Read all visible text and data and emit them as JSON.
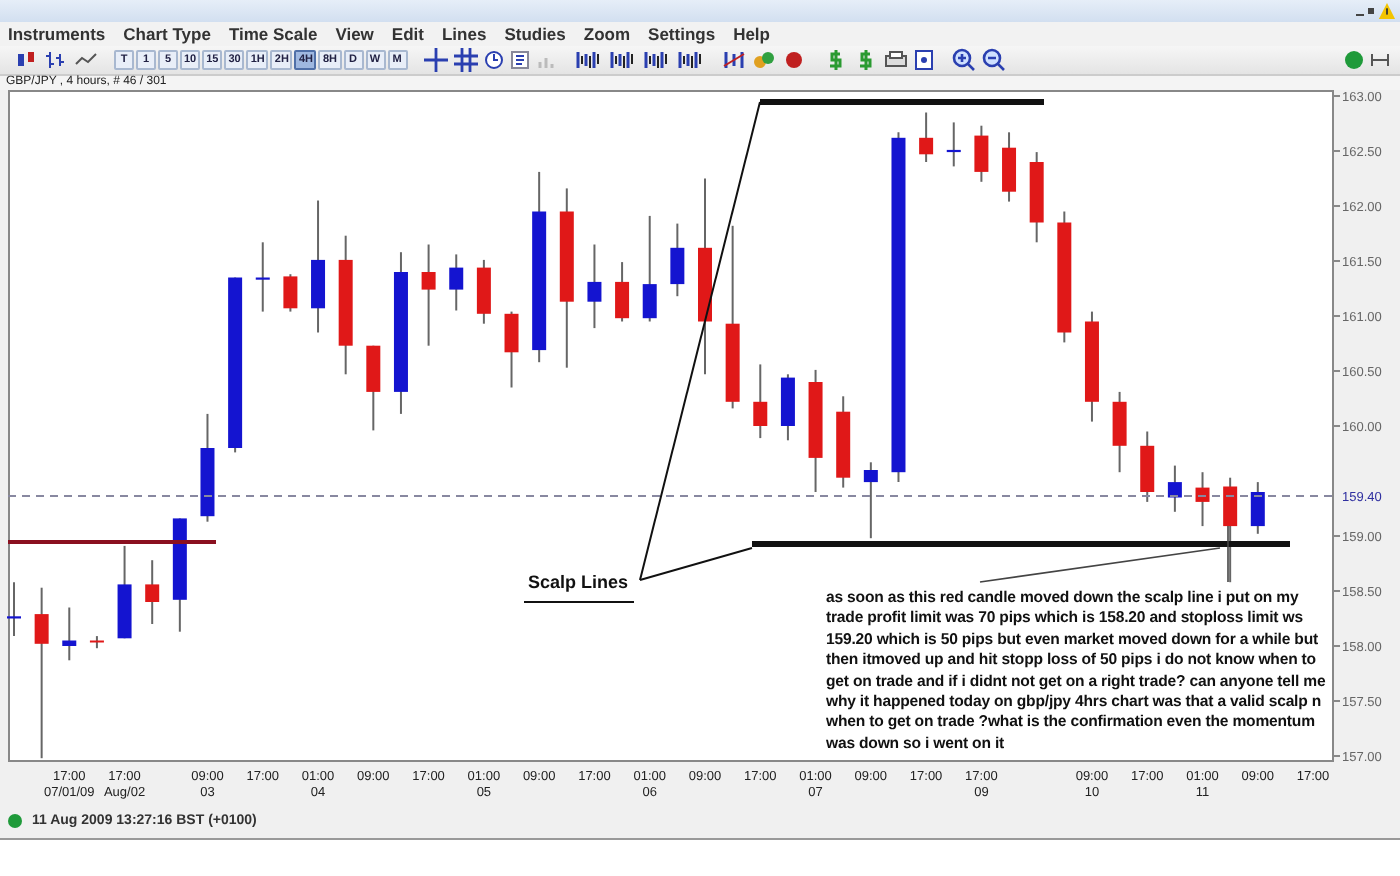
{
  "menu": [
    "Instruments",
    "Chart Type",
    "Time Scale",
    "View",
    "Edit",
    "Lines",
    "Studies",
    "Zoom",
    "Settings",
    "Help"
  ],
  "timeframes": [
    {
      "label": "T",
      "selected": false
    },
    {
      "label": "1",
      "selected": false
    },
    {
      "label": "5",
      "selected": false
    },
    {
      "label": "10",
      "selected": false
    },
    {
      "label": "15",
      "selected": false
    },
    {
      "label": "30",
      "selected": false
    },
    {
      "label": "1H",
      "selected": false
    },
    {
      "label": "2H",
      "selected": false
    },
    {
      "label": "4H",
      "selected": true
    },
    {
      "label": "8H",
      "selected": false
    },
    {
      "label": "D",
      "selected": false
    },
    {
      "label": "W",
      "selected": false
    },
    {
      "label": "M",
      "selected": false
    }
  ],
  "chart": {
    "info": "GBP/JPY , 4 hours, # 46 / 301",
    "chart_data": {
      "type": "candlestick",
      "categories": [
        null,
        null,
        "17:00\n07/01/09",
        null,
        "17:00\nAug/02",
        null,
        null,
        "09:00\n03",
        null,
        "17:00",
        null,
        "01:00\n04",
        null,
        "09:00",
        null,
        "17:00",
        null,
        "01:00\n05",
        null,
        "09:00",
        null,
        "17:00",
        null,
        "01:00\n06",
        null,
        "09:00",
        null,
        "17:00",
        null,
        "01:00\n07",
        null,
        "09:00",
        null,
        "17:00",
        null,
        "17:00\n09",
        null,
        null,
        null,
        "09:00\n10",
        null,
        "17:00",
        null,
        "01:00\n11",
        null,
        "09:00",
        null,
        "17:00"
      ],
      "ohlc": [
        [
          158.25,
          158.58,
          158.09,
          158.27
        ],
        [
          158.29,
          158.53,
          156.98,
          158.02
        ],
        [
          158.0,
          158.35,
          157.87,
          158.05
        ],
        [
          158.05,
          158.09,
          157.98,
          158.04
        ],
        [
          158.07,
          158.91,
          158.07,
          158.56
        ],
        [
          158.56,
          158.78,
          158.2,
          158.4
        ],
        [
          158.42,
          159.16,
          158.13,
          159.16
        ],
        [
          159.18,
          160.11,
          159.13,
          159.8
        ],
        [
          159.8,
          161.35,
          159.76,
          161.35
        ],
        [
          161.33,
          161.67,
          161.04,
          161.35
        ],
        [
          161.36,
          161.38,
          161.04,
          161.07
        ],
        [
          161.07,
          162.05,
          160.85,
          161.51
        ],
        [
          161.51,
          161.73,
          160.47,
          160.73
        ],
        [
          160.73,
          160.73,
          159.96,
          160.31
        ],
        [
          160.31,
          161.58,
          160.11,
          161.4
        ],
        [
          161.4,
          161.65,
          160.73,
          161.24
        ],
        [
          161.24,
          161.56,
          161.05,
          161.44
        ],
        [
          161.44,
          161.51,
          160.93,
          161.02
        ],
        [
          161.02,
          161.04,
          160.35,
          160.67
        ],
        [
          160.69,
          162.31,
          160.58,
          161.95
        ],
        [
          161.95,
          162.16,
          160.53,
          161.13
        ],
        [
          161.13,
          161.65,
          160.89,
          161.31
        ],
        [
          161.31,
          161.49,
          160.95,
          160.98
        ],
        [
          160.98,
          161.91,
          160.95,
          161.29
        ],
        [
          161.29,
          161.84,
          161.18,
          161.62
        ],
        [
          161.62,
          162.25,
          160.47,
          160.95
        ],
        [
          160.93,
          161.82,
          160.16,
          160.22
        ],
        [
          160.22,
          160.56,
          159.89,
          160.0
        ],
        [
          160.0,
          160.47,
          159.87,
          160.44
        ],
        [
          160.4,
          160.51,
          159.4,
          159.71
        ],
        [
          160.13,
          160.27,
          159.44,
          159.53
        ],
        [
          159.49,
          159.67,
          158.98,
          159.6
        ],
        [
          159.58,
          162.67,
          159.49,
          162.62
        ],
        [
          162.62,
          162.85,
          162.4,
          162.47
        ],
        [
          162.49,
          162.76,
          162.36,
          162.51
        ],
        [
          162.64,
          162.73,
          162.22,
          162.31
        ],
        [
          162.53,
          162.67,
          162.04,
          162.13
        ],
        [
          162.4,
          162.49,
          161.67,
          161.85
        ],
        [
          161.85,
          161.95,
          160.76,
          160.85
        ],
        [
          160.95,
          161.04,
          160.04,
          160.22
        ],
        [
          160.22,
          160.31,
          159.58,
          159.82
        ],
        [
          159.82,
          159.95,
          159.31,
          159.4
        ],
        [
          159.35,
          159.64,
          159.22,
          159.49
        ],
        [
          159.44,
          159.58,
          159.09,
          159.31
        ],
        [
          159.45,
          159.53,
          158.58,
          159.09
        ],
        [
          159.09,
          159.49,
          159.02,
          159.4
        ],
        null,
        null
      ],
      "ylim": [
        157,
        163
      ],
      "yticks": [
        {
          "value": 163,
          "label": "163.00"
        },
        {
          "value": 162.5,
          "label": "162.50"
        },
        {
          "value": 162,
          "label": "162.00"
        },
        {
          "value": 161.5,
          "label": "161.50"
        },
        {
          "value": 161,
          "label": "161.00"
        },
        {
          "value": 160.5,
          "label": "160.50"
        },
        {
          "value": 160,
          "label": "160.00"
        },
        {
          "value": 159,
          "label": "159.00"
        },
        {
          "value": 158.5,
          "label": "158.50"
        },
        {
          "value": 158,
          "label": "158.00"
        },
        {
          "value": 157.5,
          "label": "157.50"
        },
        {
          "value": 157,
          "label": "157.00"
        }
      ]
    },
    "current_price": "159.40",
    "label": "Scalp Lines",
    "note": "as soon as this red candle moved down the scalp line i put on my trade profit limit was 70 pips which is 158.20 and stoploss limit ws 159.20 which is 50 pips but even market moved down for a while but then itmoved up and hit stopp loss of 50 pips i do not know when to get on trade and if i didnt not get on a right trade? can anyone tell me why it happened today on gbp/jpy 4hrs chart was that a valid scalp n when to get on trade ?what is the confirmation even the momentum was down so i went on it"
  },
  "status_bar": {
    "connected": true,
    "time": "11 Aug 2009 13:27:16  BST (+0100)"
  }
}
